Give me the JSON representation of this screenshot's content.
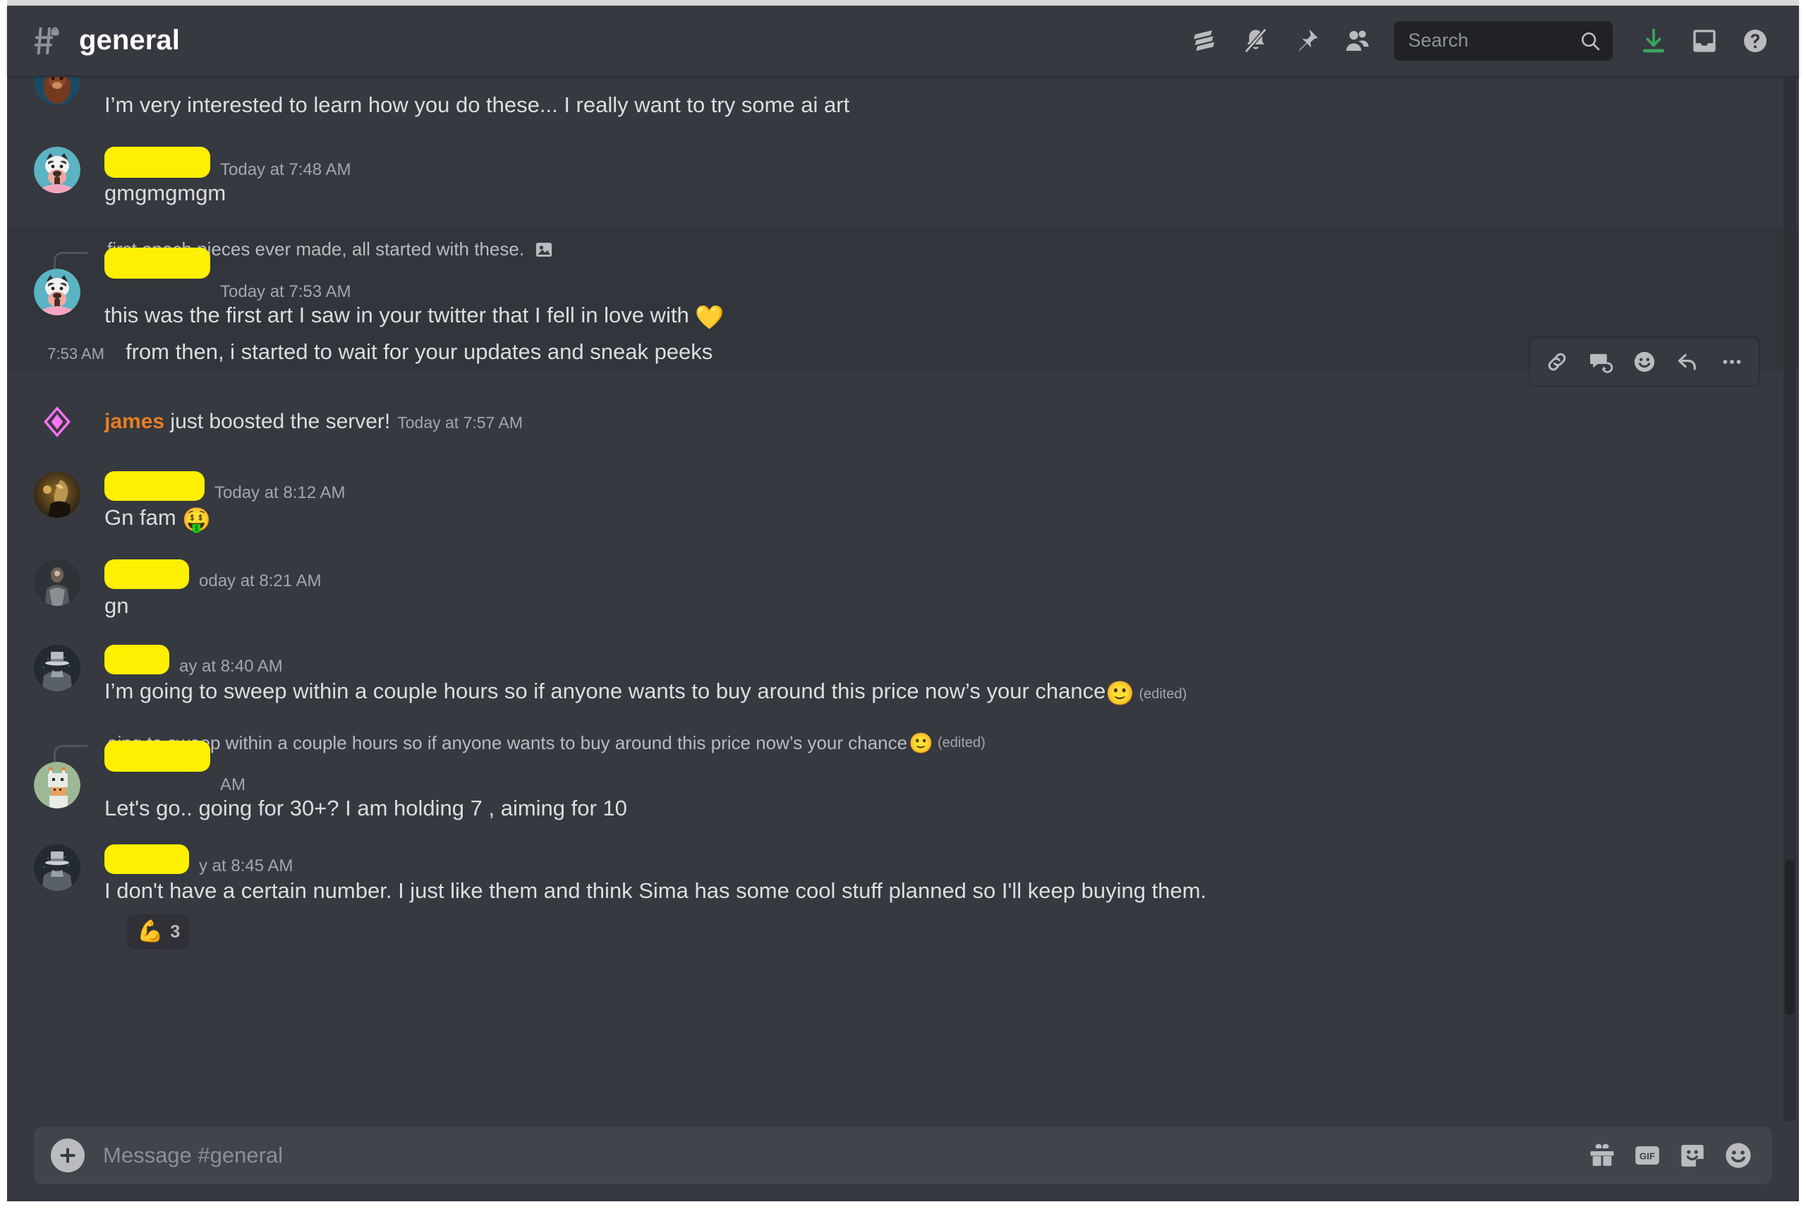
{
  "header": {
    "channel_name": "general",
    "hash_icon": "hash-lock-icon",
    "icons": [
      {
        "name": "threads-icon",
        "label": "Threads"
      },
      {
        "name": "notifications-off-icon",
        "label": "Notification Settings"
      },
      {
        "name": "pin-icon",
        "label": "Pinned Messages"
      },
      {
        "name": "members-icon",
        "label": "Member List"
      }
    ],
    "search": {
      "placeholder": "Search",
      "icon": "search-icon"
    },
    "right_icons": [
      {
        "name": "downloads-icon",
        "label": "Downloads",
        "color": "#3ba55d"
      },
      {
        "name": "inbox-icon",
        "label": "Inbox"
      },
      {
        "name": "help-icon",
        "label": "Help"
      }
    ]
  },
  "messages": [
    {
      "id": "m1",
      "type": "standard",
      "username_redacted": true,
      "redact_width": 0,
      "timestamp": "",
      "content": "I’m very interested to learn how you do these... I really want to try some ai art",
      "avatar": "avatar-ape",
      "partial_top": true
    },
    {
      "id": "m2",
      "type": "standard",
      "username_redacted": true,
      "redact_width": 148,
      "timestamp": "Today at 7:48 AM",
      "content": "gmgmgmgm",
      "avatar": "avatar-dog"
    },
    {
      "id": "m3",
      "type": "reply",
      "reply_preview_text": "first epoch pieces ever made, all started with these.",
      "reply_attachment_icon": "image-attachment-icon",
      "username_redacted": true,
      "redact_width": 148,
      "timestamp": "Today at 7:53 AM",
      "content": "this was the first art I saw in your twitter that I fell in love with",
      "content_emoji": "💛",
      "avatar": "avatar-dog",
      "hovered": true
    },
    {
      "id": "m4",
      "type": "compact",
      "gutter_timestamp": "7:53 AM",
      "content": "from then, i started to wait for your updates and sneak peeks",
      "hovered": true
    },
    {
      "id": "m5",
      "type": "boost",
      "boost_icon": "server-boost-icon",
      "boost_user": "james",
      "boost_text": " just boosted the server!",
      "timestamp": "Today at 7:57 AM"
    },
    {
      "id": "m6",
      "type": "standard",
      "username_redacted": true,
      "redact_width": 140,
      "timestamp": "Today at 8:12 AM",
      "content": "Gn fam",
      "content_emoji": "🤑",
      "avatar": "avatar-gold"
    },
    {
      "id": "m7",
      "type": "standard",
      "username_redacted": true,
      "redact_width": 118,
      "timestamp": "oday at 8:21 AM",
      "content": "gn",
      "avatar": "avatar-knight"
    },
    {
      "id": "m8",
      "type": "standard",
      "username_redacted": true,
      "redact_width": 90,
      "timestamp": "ay at 8:40 AM",
      "content": "I’m going to sweep within a couple hours so if anyone wants to buy around this price now’s your chance",
      "content_emoji": "🙂",
      "edited_label": "(edited)",
      "avatar": "avatar-tophat"
    },
    {
      "id": "m9",
      "type": "reply",
      "reply_preview_text": "oing to sweep within a couple hours so if anyone wants to buy around this price now’s your chance",
      "reply_preview_emoji": "🙂",
      "reply_edited_label": "(edited)",
      "username_redacted": true,
      "redact_width": 148,
      "timestamp": "AM",
      "content": "Let's go.. going for 30+? I am holding 7 , aiming for 10",
      "avatar": "avatar-goat"
    },
    {
      "id": "m10",
      "type": "standard",
      "username_redacted": true,
      "redact_width": 118,
      "timestamp": "y at 8:45 AM",
      "content": "I don't have a certain number. I just like them and think Sima has some cool stuff planned so I'll keep buying them.",
      "avatar": "avatar-tophat",
      "reactions": [
        {
          "emoji": "💪",
          "count": "3"
        }
      ]
    }
  ],
  "hover_toolbar": {
    "icons": [
      {
        "name": "copy-link-icon",
        "label": "Copy Link"
      },
      {
        "name": "create-thread-icon",
        "label": "Create Thread"
      },
      {
        "name": "add-reaction-icon",
        "label": "Add Reaction"
      },
      {
        "name": "reply-icon",
        "label": "Reply"
      },
      {
        "name": "more-options-icon",
        "label": "More"
      }
    ]
  },
  "input": {
    "placeholder": "Message #general",
    "plus_icon": "add-attachment-icon",
    "icons": [
      {
        "name": "gift-icon",
        "label": "Gift"
      },
      {
        "name": "gif-icon",
        "label": "GIF"
      },
      {
        "name": "sticker-icon",
        "label": "Sticker"
      },
      {
        "name": "emoji-icon",
        "label": "Emoji"
      }
    ]
  },
  "colors": {
    "app_bg": "#36393f",
    "hover_bg": "#32353b",
    "input_bg": "#40444b",
    "text": "#dcddde",
    "muted": "#a3a6aa",
    "redaction": "#ffef00",
    "boost": "#ff73fa",
    "boost_name": "#e67e22",
    "download_green": "#3ba55d"
  }
}
